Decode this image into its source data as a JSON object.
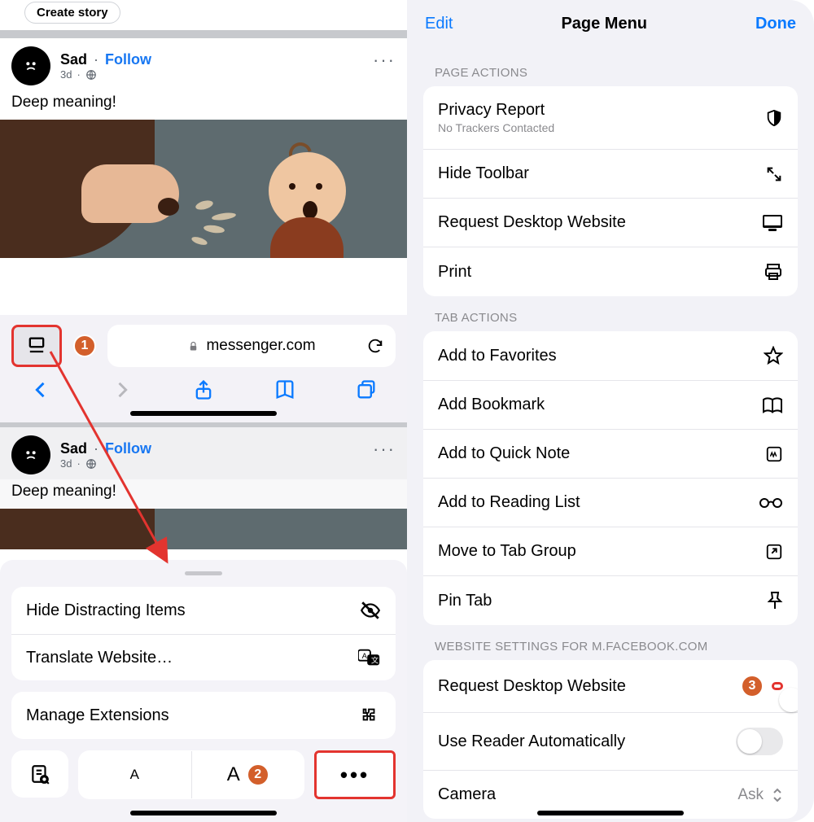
{
  "left": {
    "story_chip": "Create story",
    "post": {
      "name": "Sad",
      "dot": "·",
      "follow": "Follow",
      "age": "3d",
      "globe": "🌐",
      "body": "Deep meaning!"
    },
    "safari": {
      "url": "messenger.com"
    },
    "badges": {
      "one": "1",
      "two": "2"
    },
    "sheet": {
      "hide": "Hide Distracting Items",
      "translate": "Translate Website…",
      "manage": "Manage Extensions",
      "smallA": "A",
      "bigA": "A",
      "more": "•••"
    }
  },
  "right": {
    "edit": "Edit",
    "title": "Page Menu",
    "done": "Done",
    "sections": {
      "page_actions": "PAGE ACTIONS",
      "tab_actions": "TAB ACTIONS",
      "website_settings": "WEBSITE SETTINGS FOR M.FACEBOOK.COM"
    },
    "rows": {
      "privacy": "Privacy Report",
      "privacy_sub": "No Trackers Contacted",
      "hide_toolbar": "Hide Toolbar",
      "request_desktop": "Request Desktop Website",
      "print": "Print",
      "favorites": "Add to Favorites",
      "bookmark": "Add Bookmark",
      "quicknote": "Add to Quick Note",
      "readinglist": "Add to Reading List",
      "tabgroup": "Move to Tab Group",
      "pin": "Pin Tab",
      "req_desktop2": "Request Desktop Website",
      "reader_auto": "Use Reader Automatically",
      "camera": "Camera",
      "ask": "Ask"
    },
    "badge3": "3"
  }
}
